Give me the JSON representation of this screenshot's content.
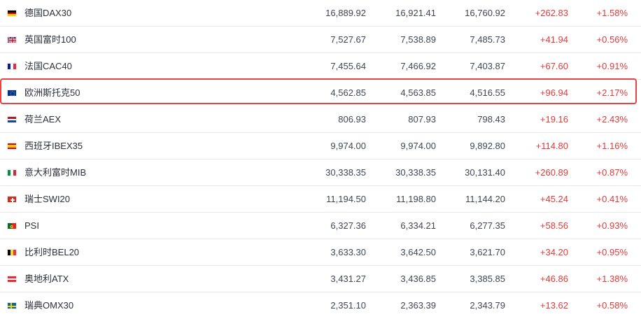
{
  "indices": [
    {
      "name": "德国DAX30",
      "flag": "germany-flag-icon",
      "last": "16,889.92",
      "high": "16,921.41",
      "low": "16,760.92",
      "change": "+262.83",
      "change_pct": "+1.58%"
    },
    {
      "name": "英国富时100",
      "flag": "uk-flag-icon",
      "last": "7,527.67",
      "high": "7,538.89",
      "low": "7,485.73",
      "change": "+41.94",
      "change_pct": "+0.56%"
    },
    {
      "name": "法国CAC40",
      "flag": "france-flag-icon",
      "last": "7,455.64",
      "high": "7,466.92",
      "low": "7,403.87",
      "change": "+67.60",
      "change_pct": "+0.91%"
    },
    {
      "name": "欧洲斯托克50",
      "flag": "eu-flag-icon",
      "last": "4,562.85",
      "high": "4,563.85",
      "low": "4,516.55",
      "change": "+96.94",
      "change_pct": "+2.17%"
    },
    {
      "name": "荷兰AEX",
      "flag": "netherlands-flag-icon",
      "last": "806.93",
      "high": "807.93",
      "low": "798.43",
      "change": "+19.16",
      "change_pct": "+2.43%"
    },
    {
      "name": "西班牙IBEX35",
      "flag": "spain-flag-icon",
      "last": "9,974.00",
      "high": "9,974.00",
      "low": "9,892.80",
      "change": "+114.80",
      "change_pct": "+1.16%"
    },
    {
      "name": "意大利富时MIB",
      "flag": "italy-flag-icon",
      "last": "30,338.35",
      "high": "30,338.35",
      "low": "30,131.40",
      "change": "+260.89",
      "change_pct": "+0.87%"
    },
    {
      "name": "瑞士SWI20",
      "flag": "switzerland-flag-icon",
      "last": "11,194.50",
      "high": "11,198.80",
      "low": "11,144.20",
      "change": "+45.24",
      "change_pct": "+0.41%"
    },
    {
      "name": "PSI",
      "flag": "portugal-flag-icon",
      "last": "6,327.36",
      "high": "6,334.21",
      "low": "6,277.35",
      "change": "+58.56",
      "change_pct": "+0.93%"
    },
    {
      "name": "比利时BEL20",
      "flag": "belgium-flag-icon",
      "last": "3,633.30",
      "high": "3,642.50",
      "low": "3,621.70",
      "change": "+34.20",
      "change_pct": "+0.95%"
    },
    {
      "name": "奥地利ATX",
      "flag": "austria-flag-icon",
      "last": "3,431.27",
      "high": "3,436.85",
      "low": "3,385.85",
      "change": "+46.86",
      "change_pct": "+1.38%"
    },
    {
      "name": "瑞典OMX30",
      "flag": "sweden-flag-icon",
      "last": "2,351.10",
      "high": "2,363.39",
      "low": "2,343.79",
      "change": "+13.62",
      "change_pct": "+0.58%"
    }
  ],
  "colors": {
    "positive": "#e03b3b",
    "highlight_border": "#e64343",
    "row_divider": "#e7e9ee",
    "text_primary": "#2a2f3a",
    "text_secondary": "#3f4654"
  },
  "highlighted_row": 3
}
